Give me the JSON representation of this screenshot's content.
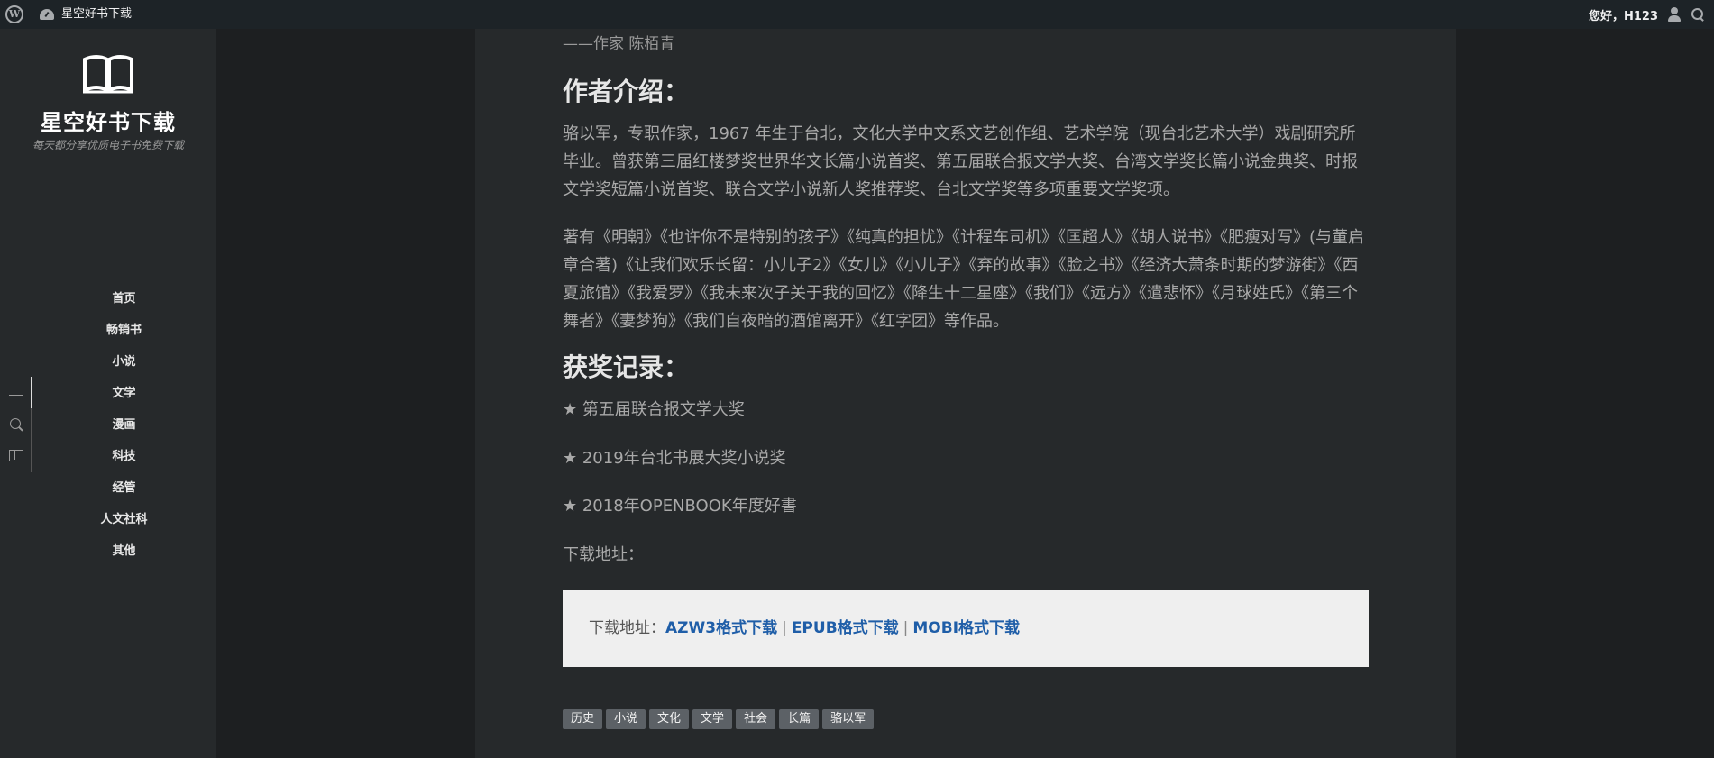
{
  "adminbar": {
    "site_name": "星空好书下载",
    "greeting": "您好，H123"
  },
  "sidebar": {
    "title": "星空好书下载",
    "subtitle": "每天都分享优质电子书免费下载",
    "nav": [
      "首页",
      "畅销书",
      "小说",
      "文学",
      "漫画",
      "科技",
      "经管",
      "人文社科",
      "其他"
    ]
  },
  "article": {
    "quote_author": "——作家 陈栢青",
    "author_heading": "作者介绍：",
    "author_bio": "骆以军，专职作家，1967 年生于台北，文化大学中文系文艺创作组、艺术学院（现台北艺术大学）戏剧研究所毕业。曾获第三届红楼梦奖世界华文长篇小说首奖、第五届联合报文学大奖、台湾文学奖长篇小说金典奖、时报文学奖短篇小说首奖、联合文学小说新人奖推荐奖、台北文学奖等多项重要文学奖项。",
    "works": "著有《明朝》《也许你不是特别的孩子》《纯真的担忧》《计程车司机》《匡超人》《胡人说书》《肥瘦对写》(与董启章合著)《让我们欢乐长留：小儿子2》《女儿》《小儿子》《弃的故事》《脸之书》《经济大萧条时期的梦游街》《西夏旅馆》《我爱罗》《我未来次子关于我的回忆》《降生十二星座》《我们》《远方》《遣悲怀》《月球姓氏》《第三个舞者》《妻梦狗》《我们自夜暗的酒馆离开》《红字团》等作品。",
    "awards_heading": "获奖记录：",
    "awards": [
      "★ 第五届联合报文学大奖",
      "★ 2019年台北书展大奖小说奖",
      "★ 2018年OPENBOOK年度好書"
    ],
    "download_label": "下载地址：",
    "download_box_label": "下载地址：",
    "links": [
      "AZW3格式下载",
      "EPUB格式下载",
      "MOBI格式下载"
    ],
    "link_separator": "|",
    "tags": [
      "历史",
      "小说",
      "文化",
      "文学",
      "社会",
      "长篇",
      "骆以军"
    ]
  }
}
